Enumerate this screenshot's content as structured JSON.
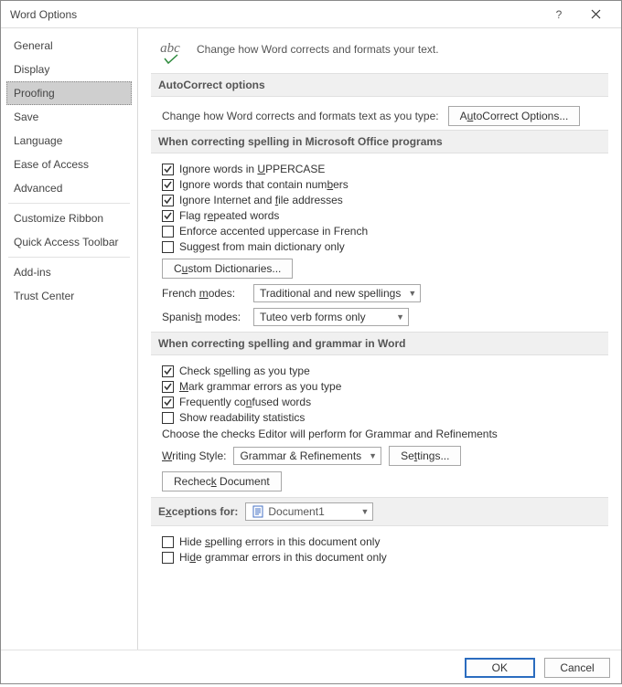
{
  "titlebar": {
    "title": "Word Options"
  },
  "sidebar": {
    "items": [
      {
        "label": "General"
      },
      {
        "label": "Display"
      },
      {
        "label": "Proofing",
        "selected": true
      },
      {
        "label": "Save"
      },
      {
        "label": "Language"
      },
      {
        "label": "Ease of Access"
      },
      {
        "label": "Advanced"
      },
      {
        "label": "Customize Ribbon"
      },
      {
        "label": "Quick Access Toolbar"
      },
      {
        "label": "Add-ins"
      },
      {
        "label": "Trust Center"
      }
    ]
  },
  "hero": {
    "icon_label": "abc",
    "text": "Change how Word corrects and formats your text."
  },
  "sections": {
    "autocorrect": {
      "title": "AutoCorrect options",
      "desc": "Change how Word corrects and formats text as you type:",
      "button_prefix": "A",
      "button_u": "u",
      "button_rest": "toCorrect Options..."
    },
    "spelling_office": {
      "title": "When correcting spelling in Microsoft Office programs",
      "checks": {
        "uppercase": {
          "pre": "Ignore words in ",
          "u": "U",
          "post": "PPERCASE",
          "checked": true
        },
        "numbers": {
          "pre": "Ignore words that contain num",
          "u": "b",
          "post": "ers",
          "checked": true
        },
        "internet": {
          "pre": "Ignore Internet and ",
          "u": "f",
          "post": "ile addresses",
          "checked": true
        },
        "repeated": {
          "pre": "Flag r",
          "u": "e",
          "post": "peated words",
          "checked": true
        },
        "accented": {
          "pre": "Enforce accented uppercase in French",
          "u": "",
          "post": "",
          "checked": false
        },
        "maindict": {
          "pre": "Suggest from main dictionary only",
          "u": "",
          "post": "",
          "checked": false
        }
      },
      "customdict_pre": "C",
      "customdict_u": "u",
      "customdict_rest": "stom Dictionaries...",
      "french_label_pre": "French ",
      "french_label_u": "m",
      "french_label_rest": "odes:",
      "french_value": "Traditional and new spellings",
      "spanish_label_pre": "Spanis",
      "spanish_label_u": "h",
      "spanish_label_rest": " modes:",
      "spanish_value": "Tuteo verb forms only"
    },
    "spelling_word": {
      "title": "When correcting spelling and grammar in Word",
      "checks": {
        "check_spelling": {
          "pre": "Check s",
          "u": "p",
          "post": "elling as you type",
          "checked": true
        },
        "mark_grammar": {
          "pre": "",
          "u": "M",
          "post": "ark grammar errors as you type",
          "checked": true
        },
        "confused": {
          "pre": "Frequently co",
          "u": "n",
          "post": "fused words",
          "checked": true
        },
        "readability": {
          "pre": "Show readability statistics",
          "u": "",
          "post": "",
          "checked": false
        }
      },
      "choose_text": "Choose the checks Editor will perform for Grammar and Refinements",
      "style_label_pre": "",
      "style_label_u": "W",
      "style_label_rest": "riting Style:",
      "style_value": "Grammar & Refinements",
      "settings_pre": "Se",
      "settings_u": "t",
      "settings_rest": "tings...",
      "recheck_pre": "Rechec",
      "recheck_u": "k",
      "recheck_rest": " Document"
    },
    "exceptions": {
      "title_pre": "E",
      "title_u": "x",
      "title_rest": "ceptions for:",
      "value": "Document1",
      "hide_spelling": {
        "pre": "Hide ",
        "u": "s",
        "post": "pelling errors in this document only",
        "checked": false
      },
      "hide_grammar": {
        "pre": "Hi",
        "u": "d",
        "post": "e grammar errors in this document only",
        "checked": false
      }
    }
  },
  "footer": {
    "ok": "OK",
    "cancel": "Cancel"
  }
}
